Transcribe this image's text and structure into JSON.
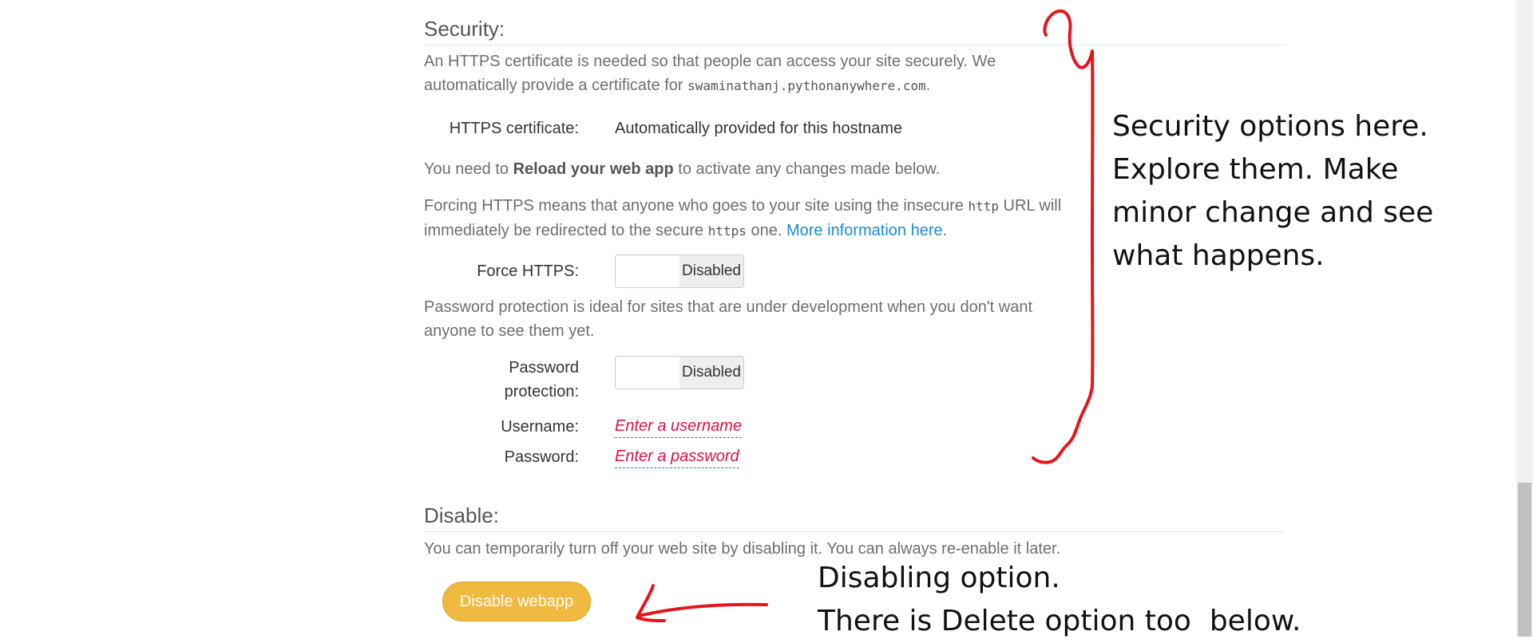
{
  "security": {
    "heading": "Security:",
    "intro_part1": "An HTTPS certificate is needed so that people can access your site securely. We automatically provide a certificate for ",
    "intro_domain": "swaminathanj.pythonanywhere.com",
    "intro_end": ".",
    "cert_label": "HTTPS certificate:",
    "cert_value": "Automatically provided for this hostname",
    "reload_pre": "You need to ",
    "reload_bold": "Reload your web app",
    "reload_post": " to activate any changes made below.",
    "force_p1": "Forcing HTTPS means that anyone who goes to your site using the insecure ",
    "force_code1": "http",
    "force_p2": " URL will immediately be redirected to the secure ",
    "force_code2": "https",
    "force_p3": " one. ",
    "force_link": "More information here",
    "force_end": ".",
    "force_label": "Force HTTPS:",
    "force_state": "Disabled",
    "pwd_text": "Password protection is ideal for sites that are under development when you don't want anyone to see them yet.",
    "pwd_label_1": "Password",
    "pwd_label_2": "protection:",
    "pwd_state": "Disabled",
    "username_label": "Username:",
    "username_placeholder": "Enter a username",
    "password_label": "Password:",
    "password_placeholder": "Enter a password"
  },
  "disable": {
    "heading": "Disable:",
    "text": "You can temporarily turn off your web site by disabling it. You can always re-enable it later.",
    "button_label": "Disable webapp"
  },
  "annotations": {
    "security_note": [
      "Security options here.",
      "Explore them. Make",
      "minor change and see",
      "what happens."
    ],
    "disable_note": [
      "Disabling option.",
      "There is Delete option too  below."
    ]
  },
  "colors": {
    "annotation_ink": "#e8141c",
    "button": "#f0b940",
    "link": "#1a8cd8",
    "placeholder": "#dd1144"
  }
}
